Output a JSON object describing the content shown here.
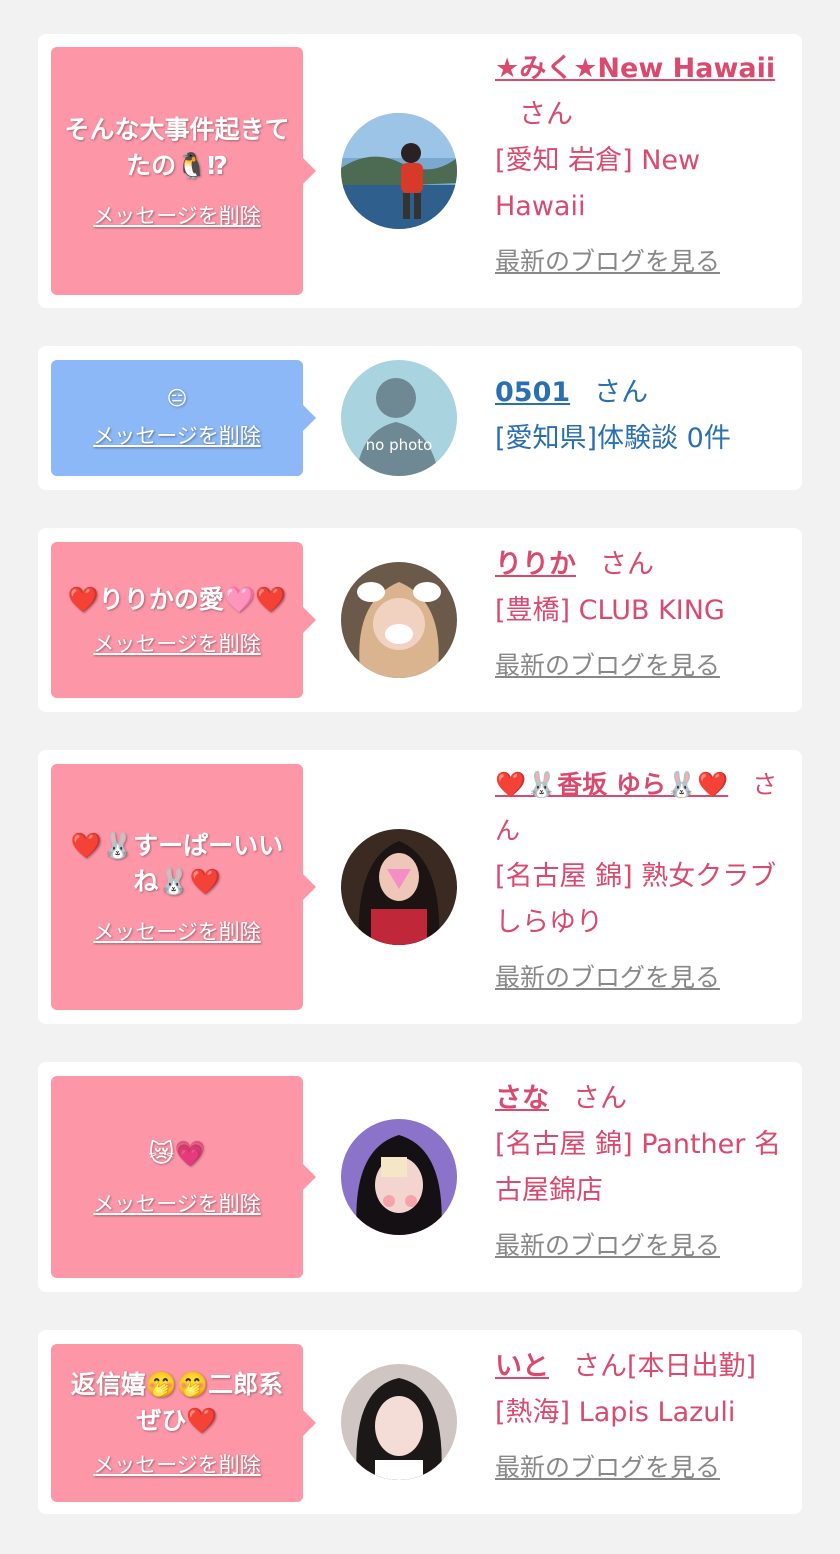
{
  "delete_label": "メッセージを削除",
  "san": "さん",
  "blog_label": "最新のブログを見る",
  "colors": {
    "bubble_pink": "#fd97a8",
    "bubble_blue": "#8cb8f7",
    "name_pink": "#d94a6e",
    "name_blue": "#2a6fb0",
    "link_gray": "#888888"
  },
  "entries": [
    {
      "message": "そんな大事件起きてたの🐧⁉",
      "name": "★みく★New Hawaii",
      "shop": "[愛知 岩倉] New Hawaii",
      "has_blog": true
    },
    {
      "message": "😑",
      "name": "0501",
      "shop": "[愛知県]体験談 0件",
      "avatar_text": "no photo",
      "has_blog": false
    },
    {
      "message": "❤️りりかの愛🩷❤️",
      "name": "りりか",
      "shop": "[豊橋] CLUB KING",
      "has_blog": true
    },
    {
      "message": "❤️🐰すーぱーいいね🐰❤️",
      "name": "❤️🐰香坂 ゆら🐰❤️",
      "shop": "[名古屋 錦] 熟女クラブしらゆり",
      "has_blog": true
    },
    {
      "message": "😿💗",
      "name": "さな",
      "shop": "[名古屋 錦] Panther 名古屋錦店",
      "has_blog": true
    },
    {
      "message": "返信嬉🤭🤭二郎系ぜひ❤️",
      "name": "いと",
      "san_suffix": "[本日出勤]",
      "shop": "[熱海] Lapis Lazuli",
      "has_blog": true
    }
  ]
}
